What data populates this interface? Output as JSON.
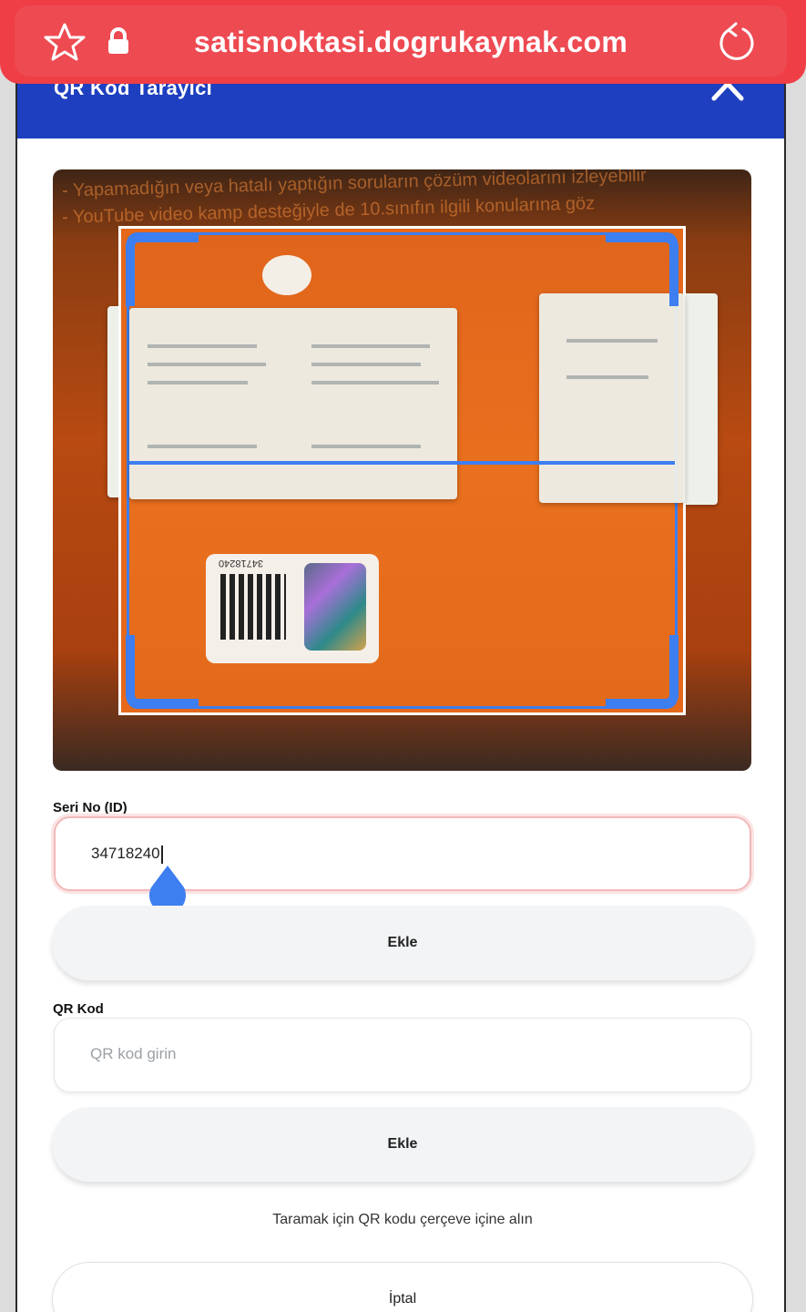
{
  "browser": {
    "url": "satisnoktasi.dogrukaynak.com",
    "accent_color": "#ef3e45"
  },
  "scanner": {
    "title": "QR Kod Tarayıcı",
    "header_color": "#1e3fbf",
    "frame_color": "#3d7ef0",
    "camera_text_line1": "- Yapamadığın veya hatalı yaptığın soruların çözüm videolarını izleyebilir",
    "camera_text_line2": "- YouTube video kamp desteğiyle de 10.sınıfın ilgili konularına göz",
    "sticker_number": "34718240"
  },
  "serial": {
    "label": "Seri No (ID)",
    "value": "34718240",
    "add_label": "Ekle"
  },
  "qr": {
    "label": "QR Kod",
    "placeholder": "QR kod girin",
    "add_label": "Ekle"
  },
  "hint": "Taramak için QR kodu çerçeve içine alın",
  "cancel_label": "İptal"
}
